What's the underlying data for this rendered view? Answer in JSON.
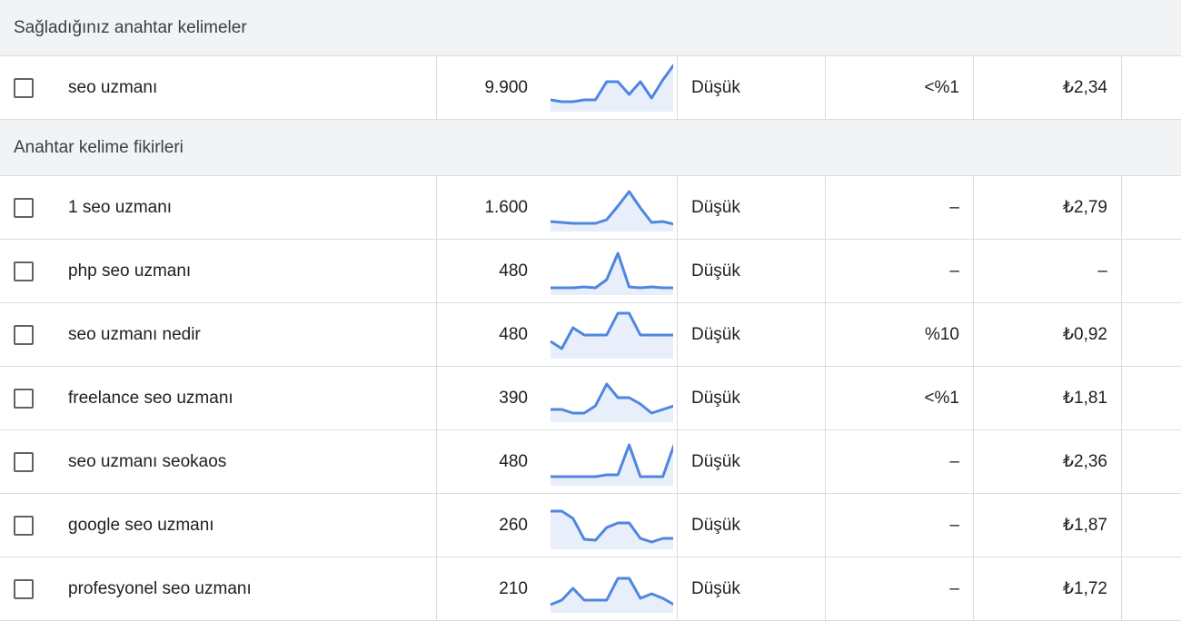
{
  "sections": [
    {
      "title": "Sağladığınız anahtar kelimeler",
      "rows": [
        {
          "keyword": "seo uzmanı",
          "volume": "9.900",
          "competition": "Düşük",
          "impression_share": "<%1",
          "bid": "₺2,34",
          "trend": [
            13,
            11,
            11,
            13,
            13,
            33,
            33,
            19,
            33,
            15,
            35,
            52
          ]
        }
      ]
    },
    {
      "title": "Anahtar kelime fikirleri",
      "rows": [
        {
          "keyword": "1 seo uzmanı",
          "volume": "1.600",
          "competition": "Düşük",
          "impression_share": "–",
          "bid": "₺2,79",
          "trend": [
            11,
            10,
            9,
            9,
            9,
            13,
            28,
            44,
            26,
            10,
            11,
            8
          ]
        },
        {
          "keyword": "php seo uzmanı",
          "volume": "480",
          "competition": "Düşük",
          "impression_share": "–",
          "bid": "–",
          "trend": [
            8,
            8,
            8,
            9,
            8,
            17,
            46,
            9,
            8,
            9,
            8,
            8
          ]
        },
        {
          "keyword": "seo uzmanı nedir",
          "volume": "480",
          "competition": "Düşük",
          "impression_share": "%10",
          "bid": "₺0,92",
          "trend": [
            19,
            11,
            34,
            26,
            26,
            26,
            50,
            50,
            26,
            26,
            26,
            26
          ]
        },
        {
          "keyword": "freelance seo uzmanı",
          "volume": "390",
          "competition": "Düşük",
          "impression_share": "<%1",
          "bid": "₺1,81",
          "trend": [
            14,
            14,
            10,
            10,
            18,
            42,
            27,
            27,
            20,
            10,
            14,
            18
          ]
        },
        {
          "keyword": "seo uzmanı seokaos",
          "volume": "480",
          "competition": "Düşük",
          "impression_share": "–",
          "bid": "₺2,36",
          "trend": [
            10,
            10,
            10,
            10,
            10,
            12,
            12,
            45,
            10,
            10,
            10,
            45
          ]
        },
        {
          "keyword": "google seo uzmanı",
          "volume": "260",
          "competition": "Düşük",
          "impression_share": "–",
          "bid": "₺1,87",
          "trend": [
            42,
            42,
            34,
            11,
            10,
            24,
            29,
            29,
            12,
            8,
            12,
            12
          ]
        },
        {
          "keyword": "profesyonel seo uzmanı",
          "volume": "210",
          "competition": "Düşük",
          "impression_share": "–",
          "bid": "₺1,72",
          "trend": [
            9,
            14,
            27,
            14,
            14,
            14,
            38,
            38,
            16,
            21,
            16,
            9
          ]
        }
      ]
    }
  ],
  "colors": {
    "trend_line": "#4f86e0",
    "trend_fill": "#e8effb"
  }
}
